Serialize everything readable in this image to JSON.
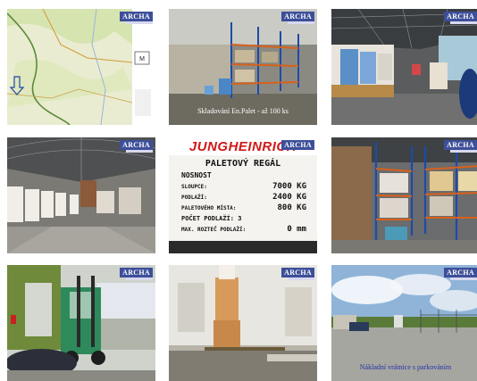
{
  "gallery": {
    "watermark": "ARCHA",
    "tiles": [
      {
        "id": "map",
        "caption": ""
      },
      {
        "id": "warehouse-racks",
        "caption": "Skladování En.Palet - až 100 ks"
      },
      {
        "id": "warehouse-goods",
        "caption": ""
      },
      {
        "id": "warehouse-hall",
        "caption": ""
      },
      {
        "id": "rack-sign",
        "caption": ""
      },
      {
        "id": "rack-aisle",
        "caption": ""
      },
      {
        "id": "forklift",
        "caption": ""
      },
      {
        "id": "pallet-truck",
        "caption": ""
      },
      {
        "id": "parking-gate",
        "caption": "Nákladní vrátnice s parkováním"
      }
    ]
  },
  "sign": {
    "brand": "JUNGHEINRICH",
    "title": "PALETOVÝ REGÁL",
    "subtitle": "NOSNOST",
    "rows": [
      {
        "label": "SLOUPCE:",
        "value": "7000 KG"
      },
      {
        "label": "PODLAŽÍ:",
        "value": "2400 KG"
      },
      {
        "label": "PALETOVÉHO MÍSTA:",
        "value": "800 KG"
      },
      {
        "label": "POČET PODLAŽÍ: 3",
        "value": ""
      },
      {
        "label": "MAX. ROZTEČ PODLAŽÍ:",
        "value": "0 mm"
      }
    ]
  },
  "colors": {
    "watermark_bg": "#3d4f9a",
    "sign_brand": "#d01818"
  }
}
